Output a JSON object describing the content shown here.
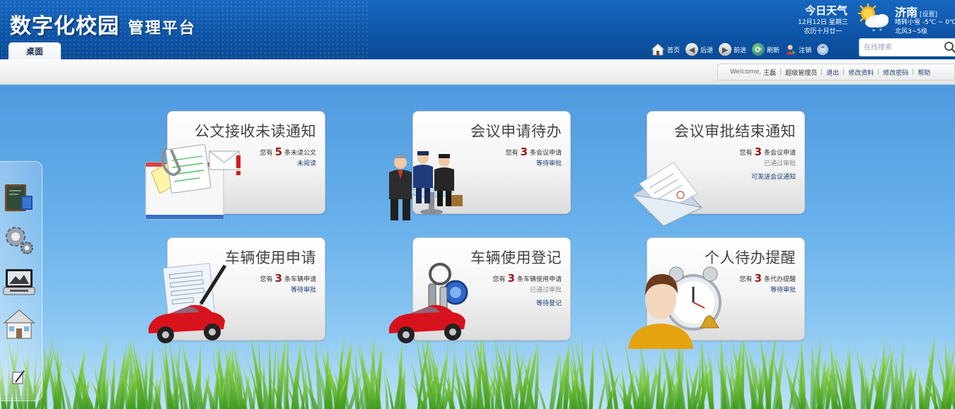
{
  "header": {
    "logo_main": "数字化校园",
    "logo_sub": "管理平台",
    "tab_desktop": "桌面"
  },
  "weather": {
    "title": "今日天气",
    "date": "12月12日 星期三",
    "lunar": "农历十月廿一",
    "city": "济南",
    "settings": "[设置]",
    "condition": "晴转小雪 -5℃ ~ 0℃",
    "wind": "北风3~5级",
    "icon": "sun-cloud-snow-icon"
  },
  "toolbar": {
    "home": "首页",
    "back": "后退",
    "forward": "前进",
    "refresh": "刷新",
    "logout": "注销"
  },
  "search": {
    "placeholder": "在线搜索"
  },
  "userbar": {
    "welcome": "Welcome,",
    "user": "王磊",
    "role": "超级管理员",
    "exit": "退出",
    "edit_profile": "修改资料",
    "change_password": "修改密码",
    "help": "帮助"
  },
  "dock": {
    "items": [
      {
        "icon": "blackboard-book-icon"
      },
      {
        "icon": "gears-icon"
      },
      {
        "icon": "laptop-icon"
      },
      {
        "icon": "house-icon"
      },
      {
        "icon": "edit-note-icon"
      }
    ]
  },
  "cards": [
    {
      "title": "公文接收未读通知",
      "line1_pre": "您有",
      "line1_num": "5",
      "line1_post": "条未读公文",
      "lines": [
        {
          "text": "未阅读",
          "style": "link"
        }
      ],
      "icon": "documents-mail-icon"
    },
    {
      "title": "会议申请待办",
      "line1_pre": "您有",
      "line1_num": "3",
      "line1_post": "条会议申请",
      "lines": [
        {
          "text": "等待审批",
          "style": "link"
        }
      ],
      "icon": "meeting-people-icon"
    },
    {
      "title": "会议审批结束通知",
      "line1_pre": "您有",
      "line1_num": "3",
      "line1_post": "条会议申请",
      "lines": [
        {
          "text": "已通过审批",
          "style": "grey"
        },
        {
          "text": "可发送会议通知",
          "style": "link"
        }
      ],
      "icon": "open-envelope-icon"
    },
    {
      "title": "车辆使用申请",
      "line1_pre": "您有",
      "line1_num": "3",
      "line1_post": "条车辆申请",
      "lines": [
        {
          "text": "等待审批",
          "style": "link"
        }
      ],
      "icon": "car-form-icon"
    },
    {
      "title": "车辆使用登记",
      "line1_pre": "您有",
      "line1_num": "3",
      "line1_post": "条车辆使用申请",
      "lines": [
        {
          "text": "已通过审批",
          "style": "grey"
        },
        {
          "text": "等待登记",
          "style": "link"
        }
      ],
      "icon": "car-key-icon"
    },
    {
      "title": "个人待办提醒",
      "line1_pre": "您有",
      "line1_num": "3",
      "line1_post": "条代办提醒",
      "lines": [
        {
          "text": "等待审批",
          "style": "link"
        }
      ],
      "icon": "person-alarm-clock-icon"
    }
  ]
}
